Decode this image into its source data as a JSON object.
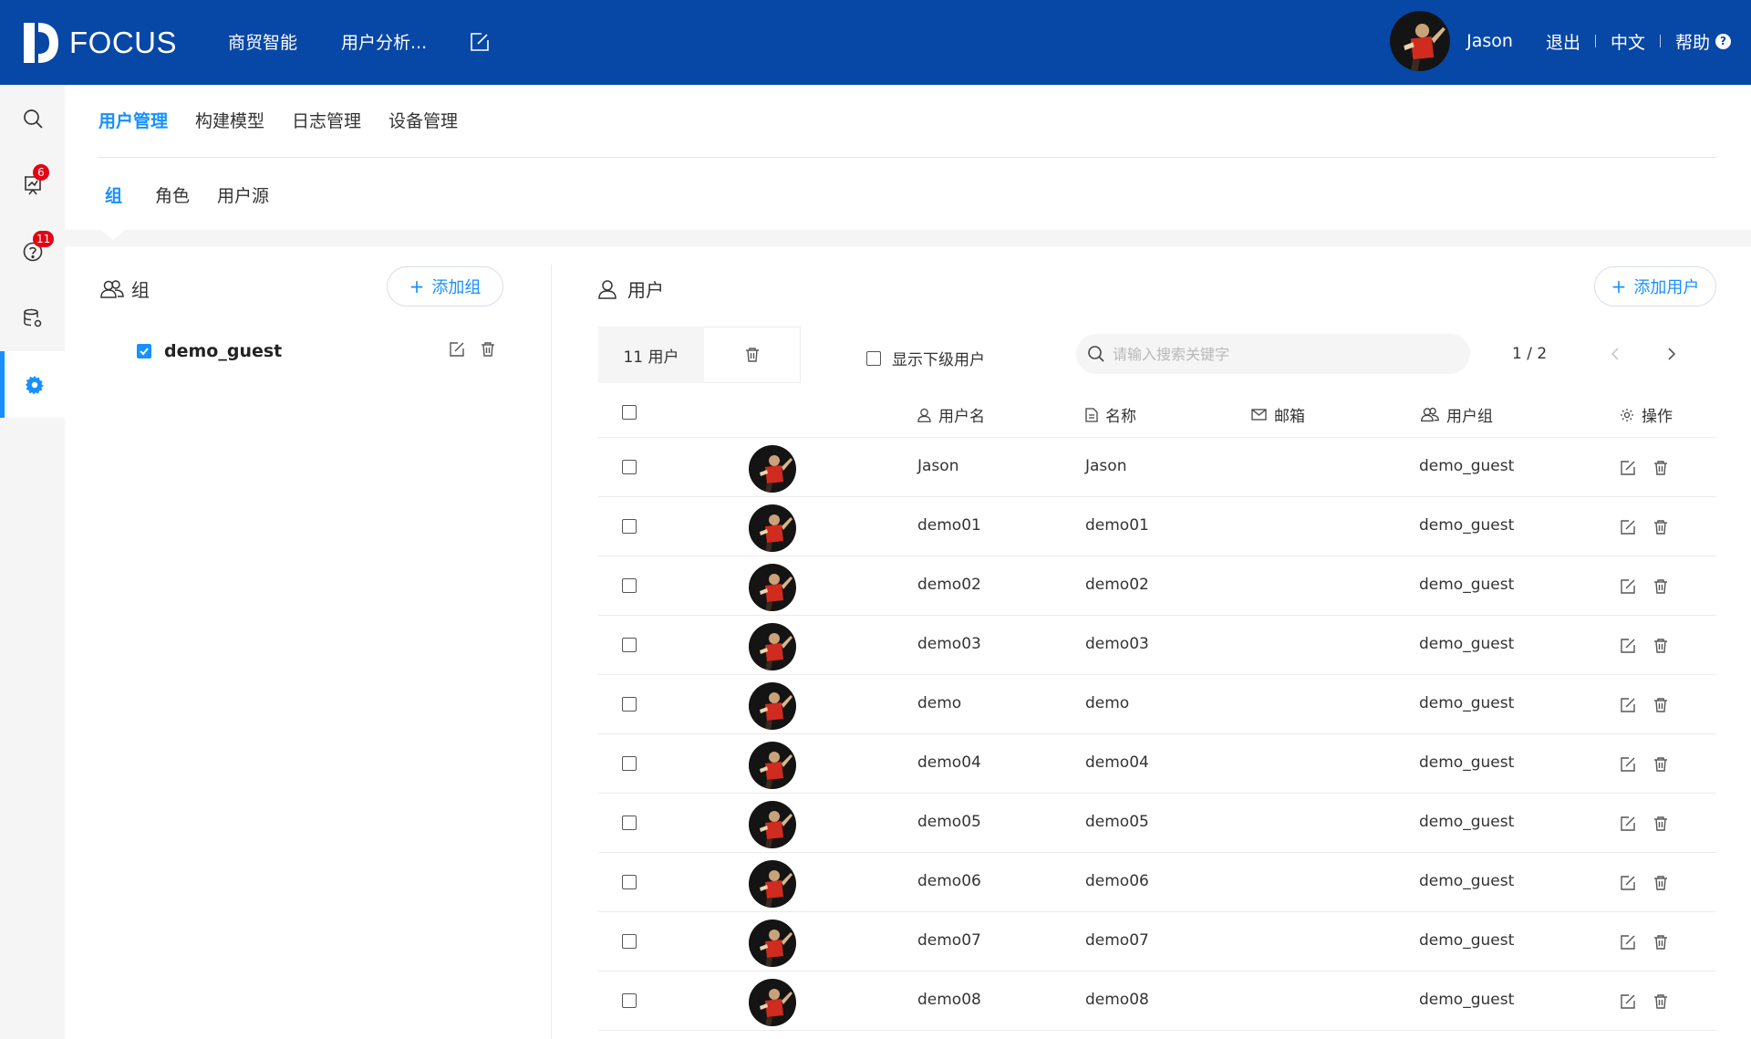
{
  "app": {
    "logo_text": "FOCUS",
    "nav": [
      "商贸智能",
      "用户分析..."
    ],
    "user_name": "Jason",
    "logout": "退出",
    "language": "中文",
    "help": "帮助",
    "help_badge": "?"
  },
  "rail": {
    "items": [
      {
        "icon": "search-icon"
      },
      {
        "icon": "presentation-chart-icon",
        "badge": "6"
      },
      {
        "icon": "question-circle-icon",
        "badge": "11"
      },
      {
        "icon": "database-settings-icon"
      },
      {
        "icon": "settings-gear-icon",
        "active": true
      }
    ]
  },
  "tabs_primary": [
    "用户管理",
    "构建模型",
    "日志管理",
    "设备管理"
  ],
  "tabs_secondary": [
    "组",
    "角色",
    "用户源"
  ],
  "groups": {
    "title": "组",
    "add_label": "添加组",
    "items": [
      {
        "name": "demo_guest",
        "checked": true
      }
    ]
  },
  "users": {
    "title": "用户",
    "add_label": "添加用户",
    "count_label": "11 用户",
    "show_sub_label": "显示下级用户",
    "search_placeholder": "请输入搜索关键字",
    "pager": "1 / 2",
    "columns": {
      "username": "用户名",
      "name": "名称",
      "email": "邮箱",
      "group": "用户组",
      "actions": "操作"
    },
    "rows": [
      {
        "username": "Jason",
        "name": "Jason",
        "email": "",
        "group": "demo_guest"
      },
      {
        "username": "demo01",
        "name": "demo01",
        "email": "",
        "group": "demo_guest"
      },
      {
        "username": "demo02",
        "name": "demo02",
        "email": "",
        "group": "demo_guest"
      },
      {
        "username": "demo03",
        "name": "demo03",
        "email": "",
        "group": "demo_guest"
      },
      {
        "username": "demo",
        "name": "demo",
        "email": "",
        "group": "demo_guest"
      },
      {
        "username": "demo04",
        "name": "demo04",
        "email": "",
        "group": "demo_guest"
      },
      {
        "username": "demo05",
        "name": "demo05",
        "email": "",
        "group": "demo_guest"
      },
      {
        "username": "demo06",
        "name": "demo06",
        "email": "",
        "group": "demo_guest"
      },
      {
        "username": "demo07",
        "name": "demo07",
        "email": "",
        "group": "demo_guest"
      },
      {
        "username": "demo08",
        "name": "demo08",
        "email": "",
        "group": "demo_guest"
      }
    ]
  },
  "colors": {
    "header_bg": "#0747a6",
    "accent": "#1890ff",
    "badge": "#e60012",
    "rail_bg": "#f5f5f5"
  }
}
